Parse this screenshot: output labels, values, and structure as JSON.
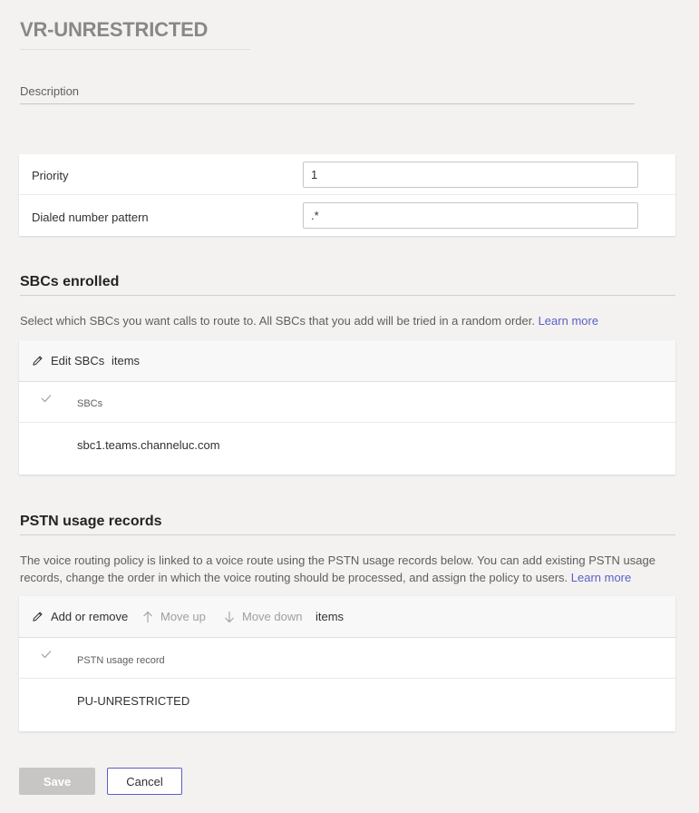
{
  "page": {
    "title": "VR-UNRESTRICTED",
    "description_label": "Description"
  },
  "fields": {
    "priority": {
      "label": "Priority",
      "value": "1"
    },
    "pattern": {
      "label": "Dialed number pattern",
      "value": ".*"
    }
  },
  "sbcs": {
    "heading": "SBCs enrolled",
    "text": "Select which SBCs you want calls to route to. All SBCs that you add will be tried in a random order.",
    "learn_more": "Learn more",
    "edit_label": "Edit SBCs",
    "items_label": "items",
    "column_header": "SBCs",
    "rows": [
      "sbc1.teams.channeluc.com"
    ]
  },
  "pstn": {
    "heading": "PSTN usage records",
    "text": "The voice routing policy is linked to a voice route using the PSTN usage records below. You can add existing PSTN usage records, change the order in which the voice routing should be processed, and assign the policy to users.",
    "learn_more": "Learn more",
    "add_remove_label": "Add or remove",
    "move_up_label": "Move up",
    "move_down_label": "Move down",
    "items_label": "items",
    "column_header": "PSTN usage record",
    "rows": [
      "PU-UNRESTRICTED"
    ]
  },
  "actions": {
    "save_label": "Save",
    "cancel_label": "Cancel"
  },
  "colors": {
    "accent": "#5b5fc7",
    "background": "#f3f2f1",
    "disabled_button": "#c8c6c4"
  },
  "icons": {
    "edit": "pencil-icon",
    "move_up": "arrow-up-icon",
    "move_down": "arrow-down-icon",
    "select_all": "checkmark-icon"
  }
}
